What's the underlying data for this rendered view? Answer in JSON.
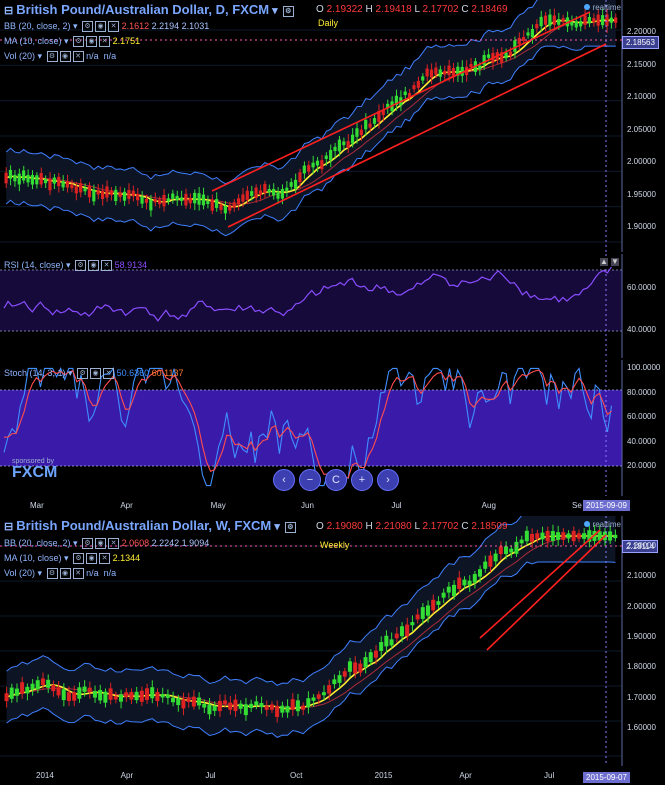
{
  "daily": {
    "title": "British Pound/Australian Dollar, D, FXCM",
    "ohlc": {
      "o_label": "O",
      "o": "2.19322",
      "h_label": "H",
      "h": "2.19418",
      "l_label": "L",
      "l": "2.17702",
      "c_label": "C",
      "c": "2.18469"
    },
    "period_badge": "Daily",
    "realtime": "realtime",
    "bb": {
      "label": "BB (20, close, 2)",
      "v1": "2.1612",
      "v2": "2.2194",
      "v3": "2.1031"
    },
    "ma": {
      "label": "MA (10, close)",
      "value": "2.1751"
    },
    "vol": {
      "label": "Vol (20)",
      "v1": "n/a",
      "v2": "n/a"
    },
    "price_tag": "2.18563",
    "y_ticks": [
      "2.20000",
      "2.15000",
      "2.10000",
      "2.05000",
      "2.00000",
      "1.95000",
      "1.90000"
    ],
    "x_ticks": [
      "Mar",
      "Apr",
      "May",
      "Jun",
      "Jul",
      "Aug",
      "Se"
    ],
    "date_tag": "2015-09-09"
  },
  "rsi": {
    "label": "RSI (14, close)",
    "value": "58.9134",
    "y_ticks": [
      "60.0000",
      "40.0000"
    ]
  },
  "stoch": {
    "label": "Stoch (14, 3, 1)",
    "v1": "50.6360",
    "v2": "60.1137",
    "y_ticks": [
      "100.0000",
      "80.0000",
      "60.0000",
      "40.0000",
      "20.0000"
    ]
  },
  "sponsor": {
    "text": "sponsored by",
    "logo": "FXCM"
  },
  "nav": [
    "‹",
    "−",
    "C",
    "+",
    "›"
  ],
  "weekly": {
    "title": "British Pound/Australian Dollar, W, FXCM",
    "ohlc": {
      "o_label": "O",
      "o": "2.19080",
      "h_label": "H",
      "h": "2.21080",
      "l_label": "L",
      "l": "2.17702",
      "c_label": "C",
      "c": "2.18509"
    },
    "period_badge": "Weekly",
    "realtime": "realtime",
    "bb": {
      "label": "BB (20, close, 2)",
      "v1": "2.0608",
      "v2": "2.2242",
      "v3": "1.9094"
    },
    "ma": {
      "label": "MA (10, close)",
      "value": "2.1344"
    },
    "vol": {
      "label": "Vol (20)",
      "v1": "n/a",
      "v2": "n/a"
    },
    "price_tag": "2.18114",
    "y_ticks": [
      "2.20000",
      "2.10000",
      "2.00000",
      "1.90000",
      "1.80000",
      "1.70000",
      "1.60000"
    ],
    "x_ticks": [
      "2014",
      "Apr",
      "Jul",
      "Oct",
      "2015",
      "Apr",
      "Jul"
    ],
    "date_tag": "2015-09-07"
  },
  "colors": {
    "up": "#33dd33",
    "down": "#dd2222",
    "ma": "#ffee33",
    "bb": "#3f7fff",
    "channel": "#ff2020",
    "rsi": "#8a4dff",
    "stoch_k": "#3f8fff",
    "stoch_d": "#ff4d4d",
    "zone": "#3a1aa8"
  }
}
